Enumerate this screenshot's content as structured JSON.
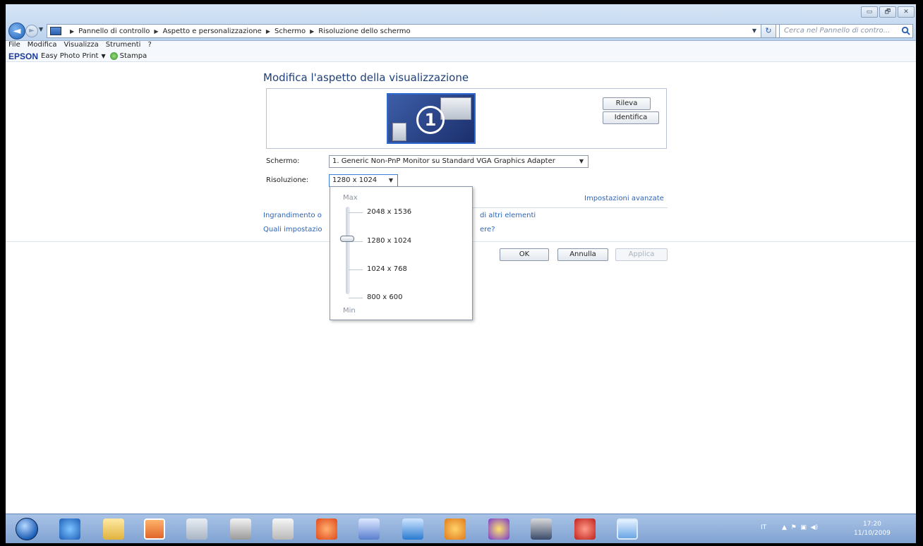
{
  "window": {
    "controls": [
      "▭",
      "🗗",
      "✕"
    ]
  },
  "address": {
    "crumbs": [
      "Pannello di controllo",
      "Aspetto e personalizzazione",
      "Schermo",
      "Risoluzione dello schermo"
    ]
  },
  "search": {
    "placeholder": "Cerca nel Pannello di contro..."
  },
  "menu": {
    "items": [
      "File",
      "Modifica",
      "Visualizza",
      "Strumenti",
      "?"
    ]
  },
  "epson": {
    "logo": "EPSON",
    "app": "Easy Photo Print",
    "print": "Stampa"
  },
  "content": {
    "title": "Modifica l'aspetto della visualizzazione",
    "monitor_number": "1",
    "rileva": "Rileva",
    "identifica": "Identifica",
    "schermo_label": "Schermo:",
    "schermo_value": "1. Generic Non-PnP Monitor su Standard VGA Graphics Adapter",
    "risoluzione_label": "Risoluzione:",
    "risoluzione_value": "1280 x 1024",
    "advanced_link": "Impostazioni avanzate",
    "zoom_text_left": "Ingrandimento o",
    "zoom_text_right": "di altri elementi",
    "which_text_left": "Quali impostazio",
    "which_text_right": "ere?",
    "ok": "OK",
    "annulla": "Annulla",
    "applica": "Applica"
  },
  "popup": {
    "max": "Max",
    "min": "Min",
    "options": [
      "2048 x 1536",
      "1280 x 1024",
      "1024 x 768",
      "800 x 600"
    ],
    "selected": "1280 x 1024"
  },
  "taskbar": {
    "tray_lang": "IT",
    "time": "17:20",
    "date": "11/10/2009"
  },
  "colors": {
    "accent": "#2a64b8",
    "title": "#1e3f7a"
  }
}
